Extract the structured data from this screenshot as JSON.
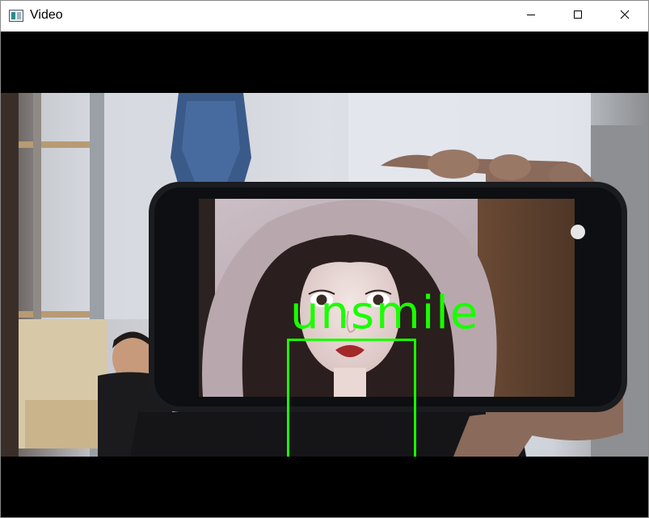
{
  "window": {
    "title": "Video",
    "icon": "window-app-icon",
    "controls": {
      "minimize_icon": "minimize-icon",
      "maximize_icon": "maximize-icon",
      "close_icon": "close-icon"
    }
  },
  "video": {
    "detection": {
      "label": "unsmile",
      "box_color": "#19ff00"
    }
  },
  "colors": {
    "letterbox": "#000000",
    "overlay": "#19ff00"
  }
}
